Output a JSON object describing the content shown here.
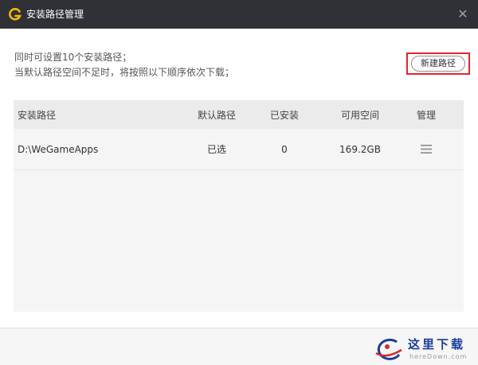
{
  "window": {
    "title": "安装路径管理",
    "close_symbol": "✕",
    "logo_icon": "wegame-logo-icon"
  },
  "hints": {
    "line1": "同时可设置10个安装路径；",
    "line2": "当默认路径空间不足时，将按照以下顺序依次下载；"
  },
  "toolbar": {
    "new_path_label": "新建路径"
  },
  "table": {
    "headers": {
      "path": "安装路径",
      "default": "默认路径",
      "installed": "已安装",
      "space": "可用空间",
      "manage": "管理"
    },
    "rows": [
      {
        "path": "D:\\WeGameApps",
        "default": "已选",
        "installed": "0",
        "space": "169.2GB",
        "manage_icon": "menu-icon"
      }
    ]
  },
  "watermark": {
    "text": "这里下载",
    "url": "hereDown.com"
  },
  "colors": {
    "titlebar": "#2f3136",
    "highlight": "#e0262d",
    "table_header": "#ebebeb",
    "table_body": "#f5f5f5",
    "logo": "#f5b800"
  }
}
